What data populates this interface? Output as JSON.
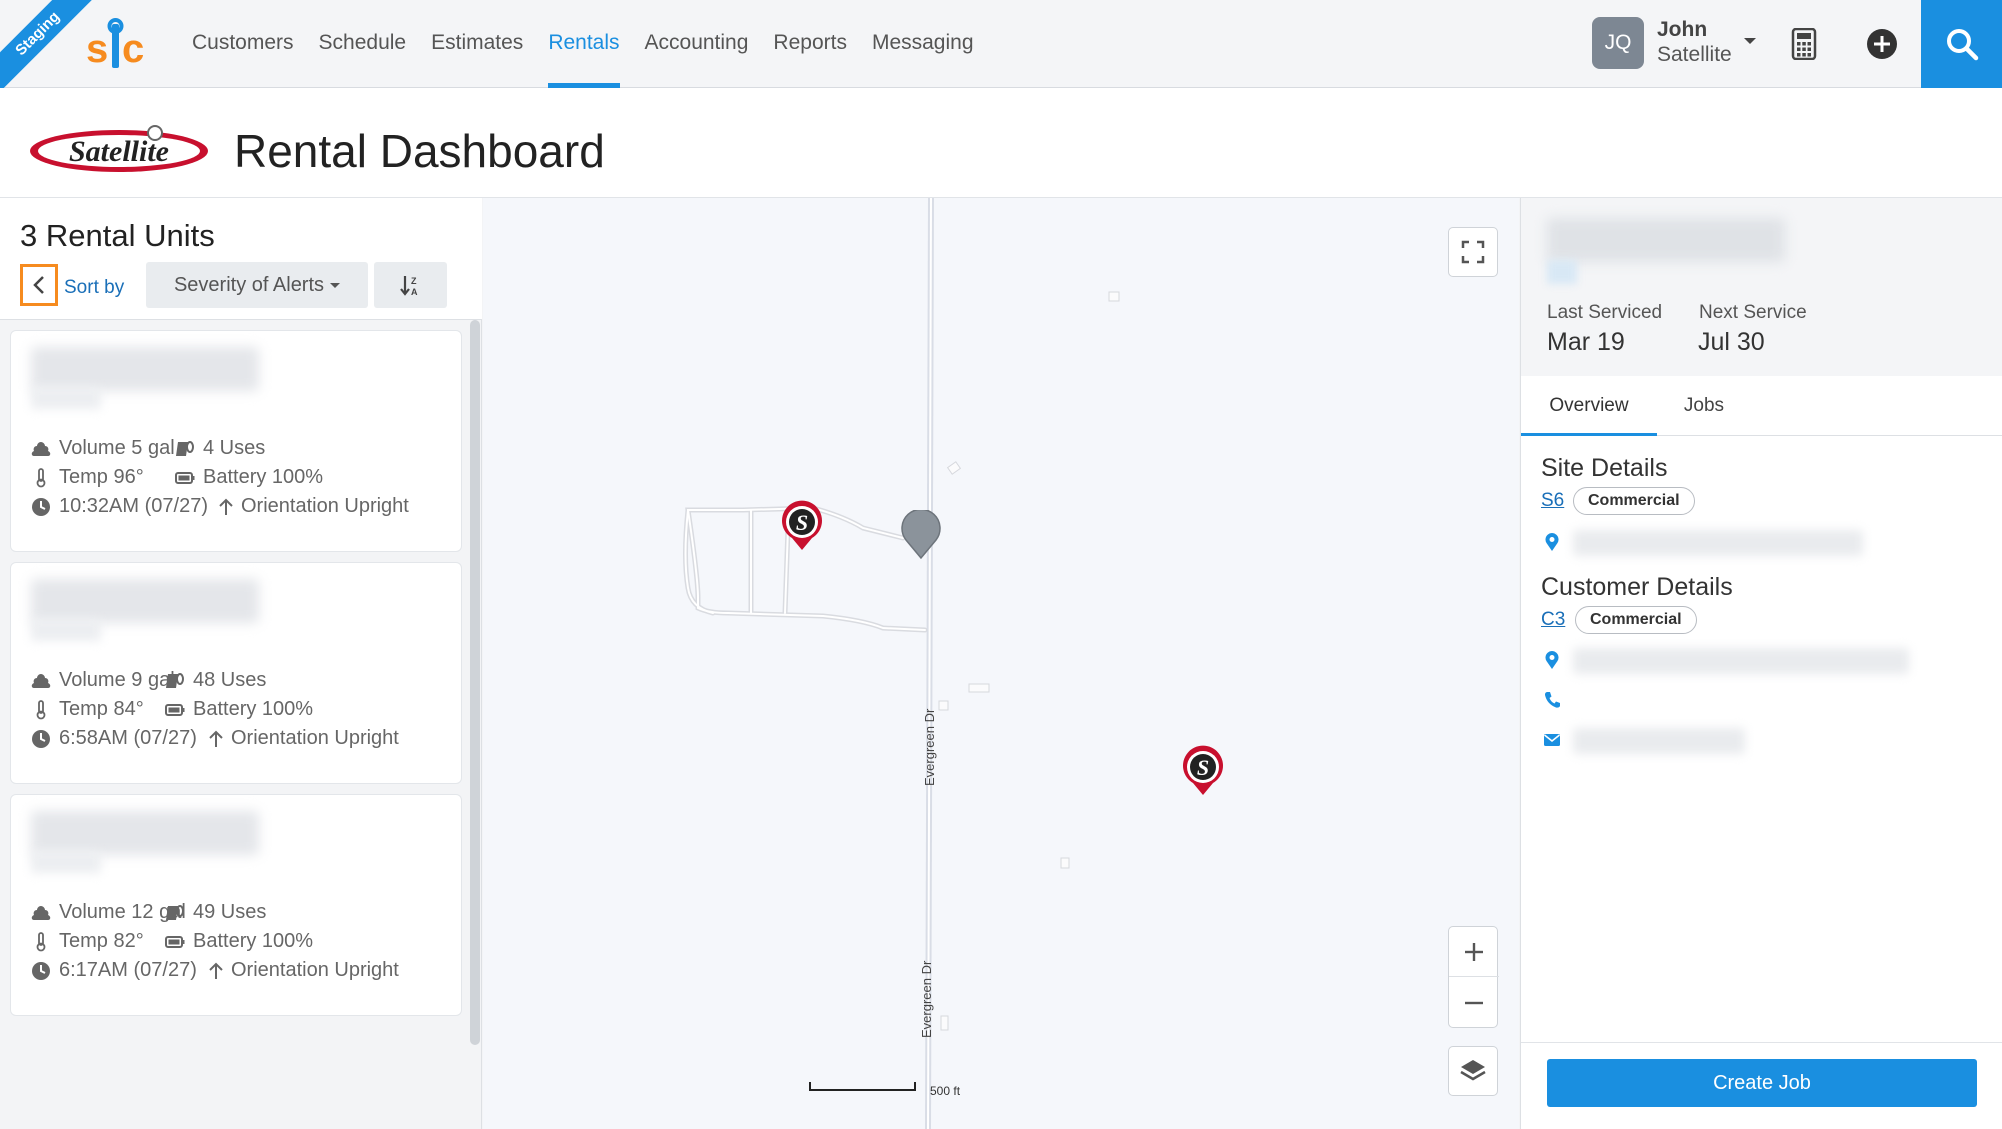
{
  "nav": {
    "badge": "Staging",
    "links": [
      {
        "label": "Customers"
      },
      {
        "label": "Schedule"
      },
      {
        "label": "Estimates"
      },
      {
        "label": "Rentals",
        "active": true
      },
      {
        "label": "Accounting"
      },
      {
        "label": "Reports"
      },
      {
        "label": "Messaging"
      }
    ],
    "user": {
      "initials": "JQ",
      "first": "John",
      "last": "Satellite"
    },
    "accent": "#1a8fe0"
  },
  "header": {
    "title": "Rental Dashboard"
  },
  "units_panel": {
    "title": "3 Rental Units",
    "sort_label": "Sort by",
    "sort_value": "Severity of Alerts",
    "units": [
      {
        "volume": "Volume 5 gal",
        "uses": "4 Uses",
        "temp": "Temp 96°",
        "battery": "Battery 100%",
        "time": "10:32AM (07/27)",
        "orientation": "Orientation Upright"
      },
      {
        "volume": "Volume 9 gal",
        "uses": "48 Uses",
        "temp": "Temp 84°",
        "battery": "Battery 100%",
        "time": "6:58AM (07/27)",
        "orientation": "Orientation Upright"
      },
      {
        "volume": "Volume 12 gal",
        "uses": "49 Uses",
        "temp": "Temp 82°",
        "battery": "Battery 100%",
        "time": "6:17AM (07/27)",
        "orientation": "Orientation Upright"
      }
    ]
  },
  "map": {
    "road_name": "Evergreen Dr",
    "scale_label": "500 ft"
  },
  "detail": {
    "last_serviced_label": "Last Serviced",
    "last_serviced_value": "Mar 19",
    "next_service_label": "Next Service",
    "next_service_value": "Jul 30",
    "tabs": [
      {
        "label": "Overview",
        "active": true
      },
      {
        "label": "Jobs"
      }
    ],
    "site_title": "Site Details",
    "site_code": "S6",
    "site_type": "Commercial",
    "customer_title": "Customer Details",
    "customer_code": "C3",
    "customer_type": "Commercial",
    "create_job_label": "Create Job"
  }
}
